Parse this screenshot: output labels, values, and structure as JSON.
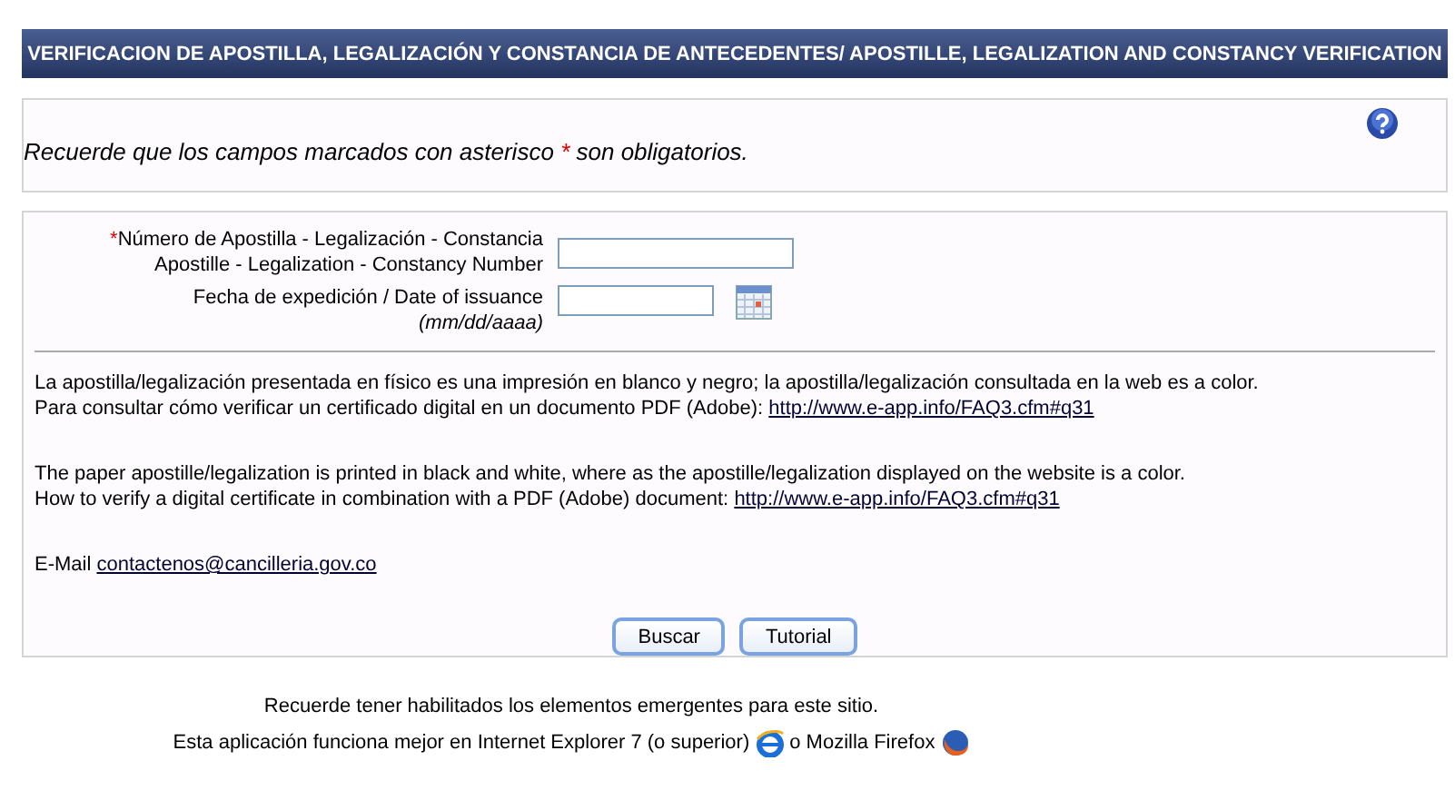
{
  "header": {
    "title": "VERIFICACION DE APOSTILLA, LEGALIZACIÓN Y CONSTANCIA DE ANTECEDENTES/ APOSTILLE, LEGALIZATION AND CONSTANCY VERIFICATION"
  },
  "notice": {
    "text": "Recuerde que los campos marcados con asterisco",
    "required_mark": "*",
    "text_end": "son obligatorios."
  },
  "fields": [
    {
      "kind": "text",
      "required_mark": "*",
      "label": "Número de Apostilla - Legalización - Constancia",
      "label_2": "Apostille - Legalization - Constancy Number"
    },
    {
      "kind": "date",
      "label": "Fecha de expedición / Date of issuance",
      "hint": "(mm/dd/aaaa)"
    }
  ],
  "paragraphs": [
    {
      "lines": [
        {
          "text": "La apostilla/legalización presentada en físico es una impresión en blanco y negro; la apostilla/legalización consultada en la web es a color."
        },
        {
          "text": "Para consultar cómo verificar un certificado digital en un documento PDF (Adobe):",
          "link": "http://www.e-app.info/FAQ3.cfm#q31"
        }
      ]
    },
    {
      "lines": [
        {
          "text": "The paper apostille/legalization is printed in black and white, where as the apostille/legalization displayed on the website is a color."
        },
        {
          "text": "How to verify a digital certificate in combination with a PDF (Adobe) document:",
          "link": "http://www.e-app.info/FAQ3.cfm#q31"
        }
      ]
    },
    {
      "lines": [
        {
          "text": "E-Mail",
          "link": "contactenos@cancilleria.gov.co"
        }
      ]
    }
  ],
  "buttons": [
    "Buscar",
    "Tutorial"
  ],
  "footer": {
    "line_1": "Recuerde tener habilitados los elementos emergentes para este sitio.",
    "line_2": "Esta aplicación funciona mejor en Internet Explorer 7 (o superior)",
    "line_2_join": "o Mozilla Firefox"
  }
}
